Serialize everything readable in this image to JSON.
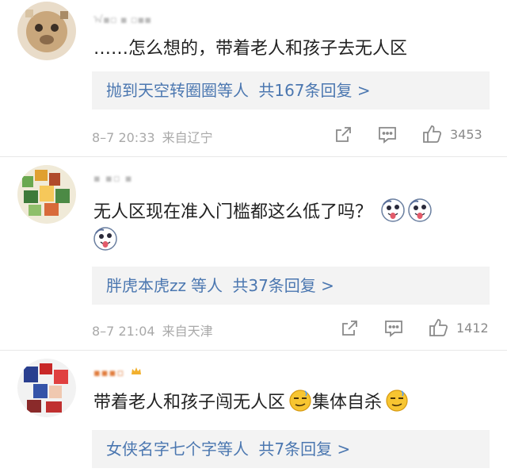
{
  "comments": [
    {
      "username": "ᠠ▪▫ ▪ ▫▪▪",
      "text": "……怎么想的，带着老人和孩子去无人区",
      "reply_names": "抛到天空转圈圈",
      "reply_suffix": "等人",
      "reply_count": "共167条回复 >",
      "time": "8–7 20:33",
      "location": "来自辽宁",
      "likes": "3453"
    },
    {
      "username": "▪ ▪▫ ▪",
      "text": "无人区现在准入门槛都这么低了吗？",
      "reply_names": "胖虎本虎zz",
      "reply_suffix": "等人",
      "reply_count": "共37条回复 >",
      "time": "8–7 21:04",
      "location": "来自天津",
      "likes": "1412"
    },
    {
      "username": "▪▪▪▫",
      "text_a": "带着老人和孩子闯无人区",
      "text_b": "集体自杀",
      "reply_names": "女侠名字七个字",
      "reply_suffix": "等人",
      "reply_count": "共7条回复 >"
    }
  ],
  "icons": {
    "share": "share-icon",
    "comment": "comment-icon",
    "like": "thumbs-up-icon",
    "emoji_tongue": "tongue-face-emoji",
    "emoji_smirk": "smirk-face-emoji",
    "badge": "crown-badge-icon"
  },
  "colors": {
    "link": "#4b77b0",
    "meta": "#a9a9a9",
    "reply_bg": "#f3f3f3"
  }
}
